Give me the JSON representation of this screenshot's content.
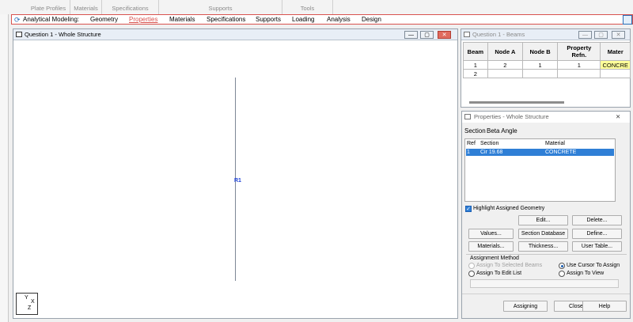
{
  "ribbon_groups": [
    "Plate Profiles",
    "Materials",
    "Specifications",
    "Supports",
    "Tools"
  ],
  "analytical_bar": {
    "label": "Analytical Modeling:",
    "tabs": [
      "Geometry",
      "Properties",
      "Materials",
      "Specifications",
      "Supports",
      "Loading",
      "Analysis",
      "Design"
    ],
    "active": "Properties"
  },
  "main_view": {
    "title": "Question 1 - Whole Structure",
    "member_label": "R1",
    "axis": {
      "y": "Y",
      "x": "X",
      "z": "Z"
    }
  },
  "beams_table": {
    "title": "Question 1 - Beams",
    "headers": [
      "Beam",
      "Node A",
      "Node B",
      "Property Refn.",
      "Mater"
    ],
    "rows": [
      [
        "1",
        "2",
        "1",
        "1",
        "CONCRE"
      ],
      [
        "2",
        "",
        "",
        "",
        ""
      ]
    ]
  },
  "properties_panel": {
    "title": "Properties - Whole Structure",
    "tabs": [
      "Section",
      "Beta Angle"
    ],
    "list_headers": [
      "Ref",
      "Section",
      "Material"
    ],
    "list_rows": [
      {
        "ref": "1",
        "section": "Cir 19.68",
        "material": "CONCRETE"
      }
    ],
    "highlight_label": "Highlight Assigned Geometry",
    "buttons": {
      "edit": "Edit...",
      "delete": "Delete...",
      "values": "Values...",
      "section_db": "Section Database",
      "define": "Define...",
      "materials": "Materials...",
      "thickness": "Thickness...",
      "user_table": "User Table..."
    },
    "assignment": {
      "title": "Assignment Method",
      "assign_selected": "Assign To Selected Beams",
      "use_cursor": "Use Cursor To Assign",
      "edit_list": "Assign To Edit List",
      "view": "Assign To View"
    },
    "footer": {
      "assigning": "Assigning",
      "close": "Close",
      "help": "Help"
    }
  },
  "colors": {
    "accent_red": "#d9534f",
    "selection_blue": "#2f7fd6",
    "member_label_blue": "#1a3fd6",
    "concrete_yellow": "#ffff99"
  }
}
